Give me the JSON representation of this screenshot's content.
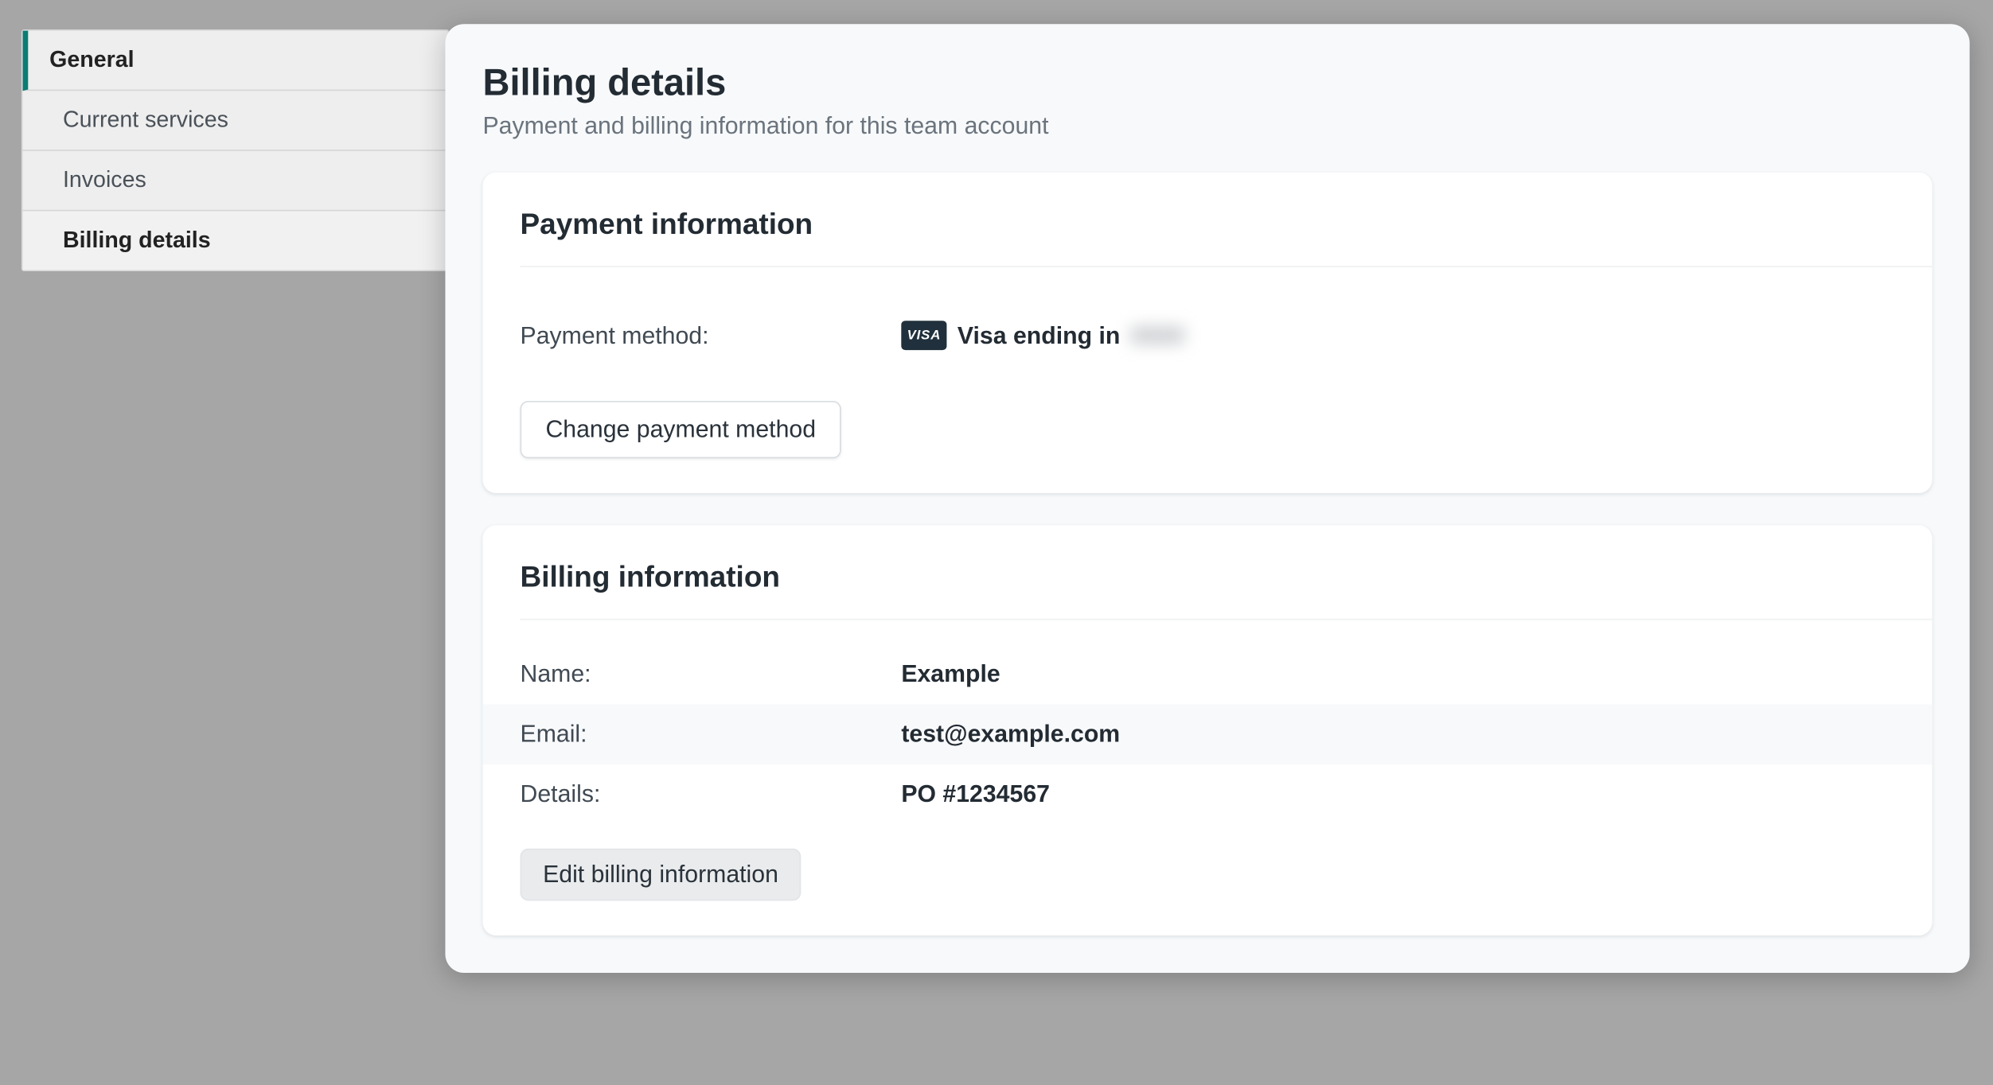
{
  "sidebar": {
    "parent": "General",
    "items": [
      {
        "label": "Current services"
      },
      {
        "label": "Invoices"
      },
      {
        "label": "Billing details"
      }
    ]
  },
  "panel": {
    "title": "Billing details",
    "subtitle": "Payment and billing information for this team account"
  },
  "payment": {
    "heading": "Payment information",
    "method_label": "Payment method:",
    "card_brand": "VISA",
    "method_text": "Visa ending in",
    "method_last4": "0000",
    "change_button": "Change payment method"
  },
  "billing": {
    "heading": "Billing information",
    "name_label": "Name:",
    "name_value": "Example",
    "email_label": "Email:",
    "email_value": "test@example.com",
    "details_label": "Details:",
    "details_value": "PO #1234567",
    "edit_button": "Edit billing information"
  }
}
